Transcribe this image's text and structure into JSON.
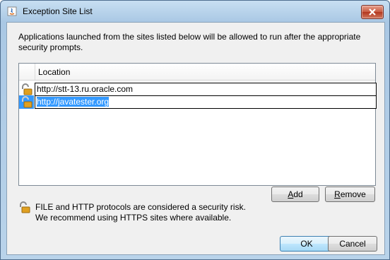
{
  "window": {
    "title": "Exception Site List",
    "icons": {
      "app": "java-icon",
      "close": "close-icon"
    }
  },
  "description": "Applications launched from the sites listed below will be allowed to run after the appropriate security prompts.",
  "table": {
    "columns": [
      "",
      "Location"
    ],
    "rows": [
      {
        "icon": "lock-icon",
        "location": "http://stt-13.ru.oracle.com",
        "selected": false
      },
      {
        "icon": "lock-icon",
        "location": "http://javatester.org",
        "selected": true
      }
    ]
  },
  "buttons": {
    "add_mnemonic": "A",
    "add_rest": "dd",
    "remove_mnemonic": "R",
    "remove_rest": "emove",
    "ok": "OK",
    "cancel": "Cancel"
  },
  "warning": {
    "icon": "lock-icon",
    "line1": "FILE and HTTP protocols are considered a security risk.",
    "line2": "We recommend using HTTPS sites where available."
  },
  "colors": {
    "selection": "#3399ff",
    "titlebar": "#aac8e4",
    "close_button": "#c75a41",
    "dialog_bg": "#f0f0f0"
  }
}
